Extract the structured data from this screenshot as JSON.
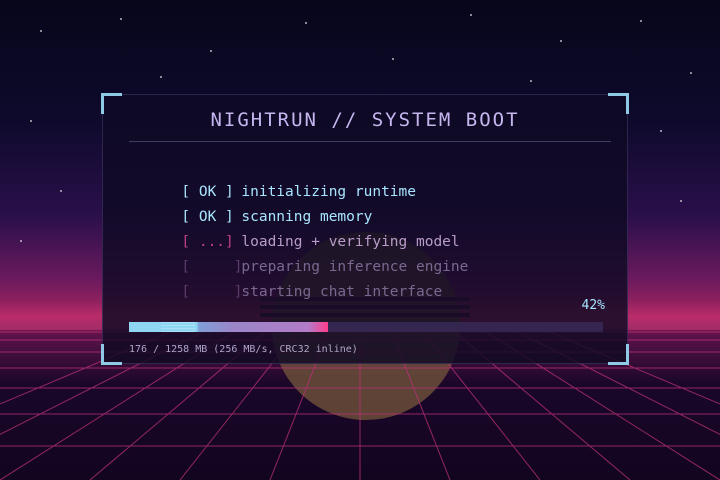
{
  "window": {
    "title": "NIGHTRUN // SYSTEM BOOT"
  },
  "boot_steps": [
    {
      "tag": "[ OK ]",
      "label": "initializing runtime",
      "state": "done"
    },
    {
      "tag": "[ OK ]",
      "label": "scanning memory",
      "state": "done"
    },
    {
      "tag": "[ ...]",
      "label": "loading + verifying model",
      "state": "active"
    },
    {
      "tag": "[     ]",
      "label": "preparing inference engine",
      "state": "pending"
    },
    {
      "tag": "[     ]",
      "label": "starting chat interface",
      "state": "pending"
    }
  ],
  "progress": {
    "percent_label": "42%",
    "fraction": 0.42,
    "status_text": "176 / 1258 MB  (256 MB/s, CRC32 inline)"
  },
  "colors": {
    "ok": "#a8e6ff",
    "active": "#c03f82",
    "pending": "#5a3a6a",
    "accent": "#ff3d8a"
  }
}
